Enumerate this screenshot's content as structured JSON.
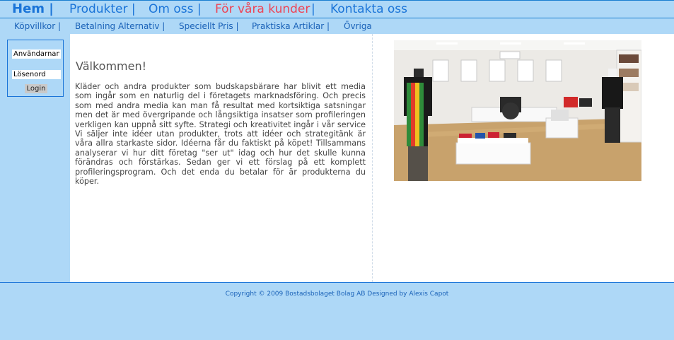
{
  "topnav": {
    "home": "Hem |",
    "produkter": "Produkter |",
    "omoss": "Om oss |",
    "kunder": "För våra kunder",
    "kunder_sep": "|",
    "kontakt": "Kontakta oss"
  },
  "subnav": {
    "items": [
      "Köpvillkor |",
      "Betalning Alternativ |",
      "Speciellt Pris |",
      "Praktiska Artiklar |",
      "Övriga"
    ]
  },
  "login": {
    "username_value": "Användarnamn",
    "password_value": "Lösenord",
    "button": "Login"
  },
  "content": {
    "heading": "Välkommen!",
    "body": "Kläder och andra produkter som budskapsbärare har blivit ett media som ingår som en naturlig del i företagets marknadsföring. Och precis som med andra media kan man få resultat med kortsiktiga satsningar  men det är med övergripande och långsiktiga insatser som profileringen verkligen kan uppnå sitt syfte. Strategi och kreativitet ingår i vår service Vi säljer inte idéer utan produkter, trots att idéer och strategitänk är våra allra starkaste sidor. Idéerna får du faktiskt på köpet! Tillsammans analyserar vi hur ditt företag \"ser ut\" idag och hur det skulle kunna förändras och förstärkas. Sedan ger vi ett förslag på ett komplett profileringsprogram. Och det enda du betalar för är produkterna du köper."
  },
  "footer": {
    "copyright": "Copyright © 2009 Bostadsbolaget Bolag AB Designed by Alexis Capot"
  },
  "colors": {
    "nav_bg": "#aed8f7",
    "link_blue": "#1a74d8",
    "active_red": "#ee4455"
  }
}
